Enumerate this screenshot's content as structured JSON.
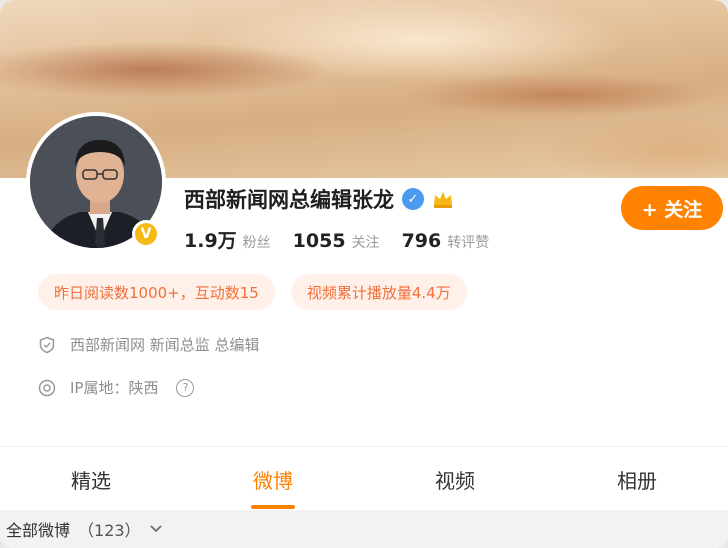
{
  "profile": {
    "name": "西部新闻网总编辑张龙",
    "avatar_badge": "V",
    "follow_label": "+ 关注",
    "stats": [
      {
        "value": "1.9万",
        "label": "粉丝"
      },
      {
        "value": "1055",
        "label": "关注"
      },
      {
        "value": "796",
        "label": "转评赞"
      }
    ],
    "tags": [
      "昨日阅读数1000+，互动数15",
      "视频累计播放量4.4万"
    ],
    "info": {
      "company": "西部新闻网 新闻总监 总编辑",
      "ip_location": "IP属地：陕西"
    }
  },
  "tabs": [
    {
      "label": "精选",
      "active": false
    },
    {
      "label": "微博",
      "active": true
    },
    {
      "label": "视频",
      "active": false
    },
    {
      "label": "相册",
      "active": false
    }
  ],
  "filter": {
    "label": "全部微博",
    "count": "（123）"
  },
  "colors": {
    "accent": "#ff8200",
    "verified_blue": "#4a9bf0",
    "badge_gold": "#f5b915",
    "tag_text": "#f0703a",
    "tag_bg": "#fff1ea"
  },
  "icons": [
    "verified-icon",
    "crown-icon",
    "shield-icon",
    "location-icon",
    "help-icon",
    "chevron-down-icon"
  ]
}
